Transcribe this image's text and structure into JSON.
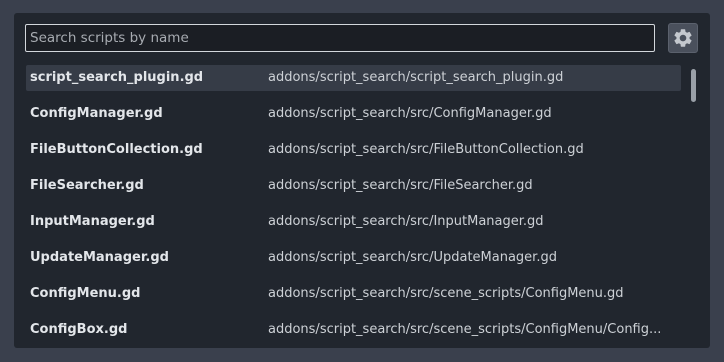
{
  "search": {
    "placeholder": "Search scripts by name",
    "value": ""
  },
  "settings_button": {
    "icon": "gear-icon"
  },
  "results": [
    {
      "name": "script_search_plugin.gd",
      "path": "addons/script_search/script_search_plugin.gd",
      "selected": true
    },
    {
      "name": "ConfigManager.gd",
      "path": "addons/script_search/src/ConfigManager.gd",
      "selected": false
    },
    {
      "name": "FileButtonCollection.gd",
      "path": "addons/script_search/src/FileButtonCollection.gd",
      "selected": false
    },
    {
      "name": "FileSearcher.gd",
      "path": "addons/script_search/src/FileSearcher.gd",
      "selected": false
    },
    {
      "name": "InputManager.gd",
      "path": "addons/script_search/src/InputManager.gd",
      "selected": false
    },
    {
      "name": "UpdateManager.gd",
      "path": "addons/script_search/src/UpdateManager.gd",
      "selected": false
    },
    {
      "name": "ConfigMenu.gd",
      "path": "addons/script_search/src/scene_scripts/ConfigMenu.gd",
      "selected": false
    },
    {
      "name": "ConfigBox.gd",
      "path": "addons/script_search/src/scene_scripts/ConfigMenu/Config...",
      "selected": false
    }
  ],
  "colors": {
    "background": "#3a404d",
    "panel": "#21262e",
    "selected_row": "#363c47",
    "search_border": "#d3d7dc"
  }
}
